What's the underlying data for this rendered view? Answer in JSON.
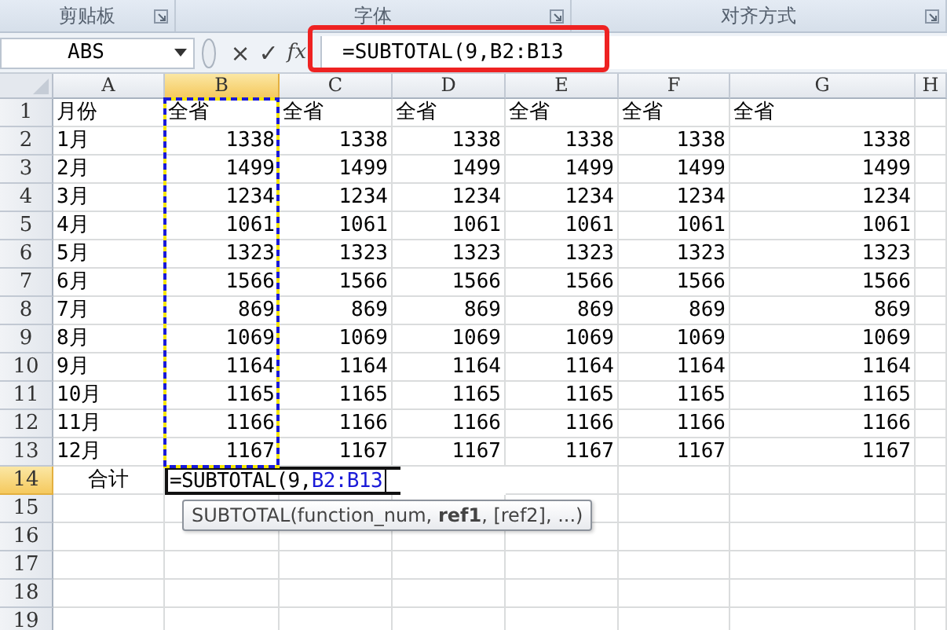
{
  "ribbon_groups": [
    {
      "label": "剪贴板"
    },
    {
      "label": "字体"
    },
    {
      "label": "对齐方式"
    }
  ],
  "name_box": {
    "value": "ABS"
  },
  "formula_buttons": [
    {
      "label": "×"
    },
    {
      "label": "✓"
    },
    {
      "label": "fx"
    }
  ],
  "formula_bar": {
    "value": "=SUBTOTAL(9,B2:B13",
    "highlighted": true
  },
  "columns": [
    {
      "label": "A",
      "selected": false
    },
    {
      "label": "B",
      "selected": true
    },
    {
      "label": "C",
      "selected": false
    },
    {
      "label": "D",
      "selected": false
    },
    {
      "label": "E",
      "selected": false
    },
    {
      "label": "F",
      "selected": false
    },
    {
      "label": "G",
      "selected": false
    },
    {
      "label": "H",
      "selected": false
    }
  ],
  "rows": [
    {
      "number": "1",
      "selected": false,
      "kind": "header",
      "label": "月份",
      "values": [
        "全省",
        "全省",
        "全省",
        "全省",
        "全省",
        "全省"
      ]
    },
    {
      "number": "2",
      "selected": false,
      "kind": "data",
      "label": "1月",
      "values": [
        "1338",
        "1338",
        "1338",
        "1338",
        "1338",
        "1338"
      ]
    },
    {
      "number": "3",
      "selected": false,
      "kind": "data",
      "label": "2月",
      "values": [
        "1499",
        "1499",
        "1499",
        "1499",
        "1499",
        "1499"
      ]
    },
    {
      "number": "4",
      "selected": false,
      "kind": "data",
      "label": "3月",
      "values": [
        "1234",
        "1234",
        "1234",
        "1234",
        "1234",
        "1234"
      ]
    },
    {
      "number": "5",
      "selected": false,
      "kind": "data",
      "label": "4月",
      "values": [
        "1061",
        "1061",
        "1061",
        "1061",
        "1061",
        "1061"
      ]
    },
    {
      "number": "6",
      "selected": false,
      "kind": "data",
      "label": "5月",
      "values": [
        "1323",
        "1323",
        "1323",
        "1323",
        "1323",
        "1323"
      ]
    },
    {
      "number": "7",
      "selected": false,
      "kind": "data",
      "label": "6月",
      "values": [
        "1566",
        "1566",
        "1566",
        "1566",
        "1566",
        "1566"
      ]
    },
    {
      "number": "8",
      "selected": false,
      "kind": "data",
      "label": "7月",
      "values": [
        "869",
        "869",
        "869",
        "869",
        "869",
        "869"
      ]
    },
    {
      "number": "9",
      "selected": false,
      "kind": "data",
      "label": "8月",
      "values": [
        "1069",
        "1069",
        "1069",
        "1069",
        "1069",
        "1069"
      ]
    },
    {
      "number": "10",
      "selected": false,
      "kind": "data",
      "label": "9月",
      "values": [
        "1164",
        "1164",
        "1164",
        "1164",
        "1164",
        "1164"
      ]
    },
    {
      "number": "11",
      "selected": false,
      "kind": "data",
      "label": "10月",
      "values": [
        "1165",
        "1165",
        "1165",
        "1165",
        "1165",
        "1165"
      ]
    },
    {
      "number": "12",
      "selected": false,
      "kind": "data",
      "label": "11月",
      "values": [
        "1166",
        "1166",
        "1166",
        "1166",
        "1166",
        "1166"
      ]
    },
    {
      "number": "13",
      "selected": false,
      "kind": "data",
      "label": "12月",
      "values": [
        "1167",
        "1167",
        "1167",
        "1167",
        "1167",
        "1167"
      ]
    },
    {
      "number": "14",
      "selected": true,
      "kind": "total",
      "label": "合计",
      "editing": {
        "prefix": "=SUBTOTAL(9,",
        "reference": "B2:B13"
      }
    },
    {
      "number": "15",
      "selected": false,
      "kind": "empty"
    },
    {
      "number": "16",
      "selected": false,
      "kind": "empty"
    },
    {
      "number": "17",
      "selected": false,
      "kind": "empty"
    },
    {
      "number": "18",
      "selected": false,
      "kind": "empty"
    },
    {
      "number": "19",
      "selected": false,
      "kind": "empty"
    }
  ],
  "tooltip": {
    "text": "SUBTOTAL(function_num, **ref1**, [ref2], ...)"
  }
}
